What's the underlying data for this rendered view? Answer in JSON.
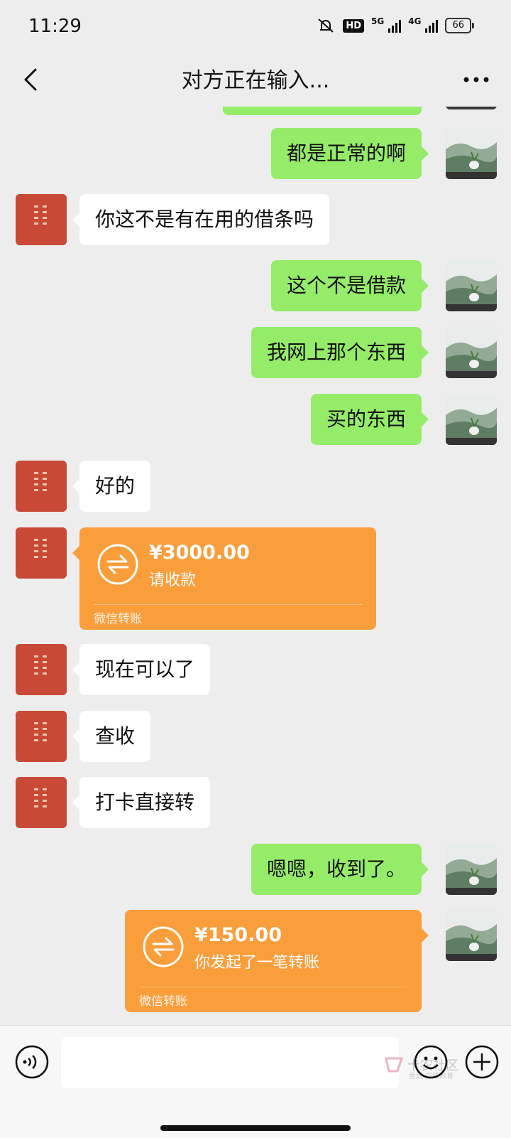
{
  "status": {
    "time": "11:29",
    "hd": "HD",
    "net1": "5G",
    "net2": "4G",
    "battery": "66"
  },
  "header": {
    "title": "对方正在输入..."
  },
  "messages": {
    "m1": "都是正常的啊",
    "m2": "你这不是有在用的借条吗",
    "m3": "这个不是借款",
    "m4": "我网上那个东西",
    "m5": "买的东西",
    "m6": "好的",
    "t1": {
      "amount": "¥3000.00",
      "desc": "请收款",
      "foot": "微信转账"
    },
    "m7": "现在可以了",
    "m8": "查收",
    "m9": "打卡直接转",
    "m10": "嗯嗯，收到了。",
    "t2": {
      "amount": "¥150.00",
      "desc": "你发起了一笔转账",
      "foot": "微信转账"
    }
  },
  "watermark": {
    "text": "卡农社区",
    "sub": "金融·在线教育"
  },
  "colors": {
    "bg": "#ededed",
    "self_bubble": "#95ec69",
    "transfer": "#fa9d3b"
  }
}
